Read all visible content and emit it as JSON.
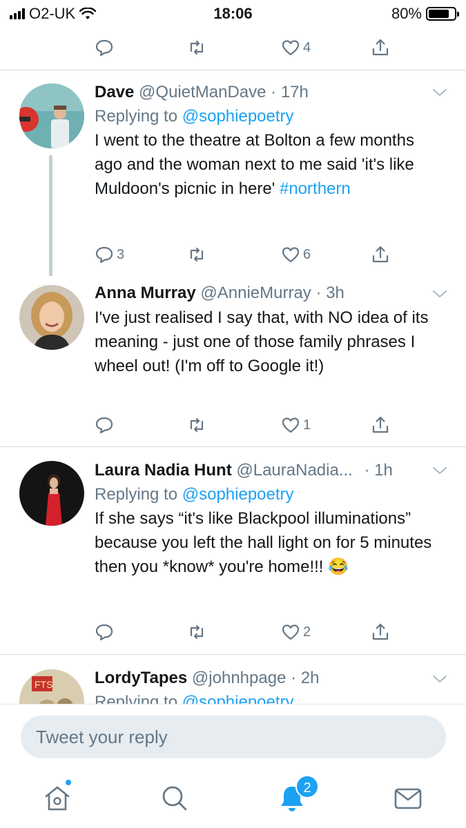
{
  "status_bar": {
    "carrier": "O2-UK",
    "time": "18:06",
    "battery_percent": "80%",
    "battery_level": 0.8
  },
  "top_actions": {
    "like_count": "4"
  },
  "tweets": [
    {
      "name": "Dave",
      "handle": "@QuietManDave",
      "time": "· 17h",
      "replying_prefix": "Replying to",
      "replying_to": "@sophiepoetry",
      "text": "I went to the theatre at Bolton a few months ago and the woman next to me said 'it's like Muldoon's picnic in here'",
      "hashtag": "#northern",
      "reply_count": "3",
      "like_count": "6"
    },
    {
      "name": "Anna Murray",
      "handle": "@AnnieMurray",
      "time": "· 3h",
      "text": "I've just realised I say that, with NO idea of its meaning - just one of those family phrases I wheel out! (I'm off to Google it!)",
      "like_count": "1"
    },
    {
      "name": "Laura Nadia Hunt",
      "handle": "@LauraNadia...",
      "time": "· 1h",
      "replying_prefix": "Replying to",
      "replying_to": "@sophiepoetry",
      "text": "If she says “it's like Blackpool illuminations” because you left the hall light on for 5 minutes then you *know* you're home!!!",
      "emoji": "😂",
      "like_count": "2"
    },
    {
      "name": "LordyTapes",
      "handle": "@johnhpage",
      "time": "· 2h",
      "replying_prefix": "Replying to",
      "replying_to": "@sophiepoetry",
      "avatar_label": "FTS"
    }
  ],
  "reply_bar": {
    "placeholder": "Tweet your reply"
  },
  "tab_bar": {
    "items": [
      "home-icon",
      "search-icon",
      "notifications-icon",
      "messages-icon"
    ],
    "notification_badge": "2"
  },
  "colors": {
    "accent": "#1da1f2",
    "muted": "#657786",
    "text": "#14171a"
  }
}
